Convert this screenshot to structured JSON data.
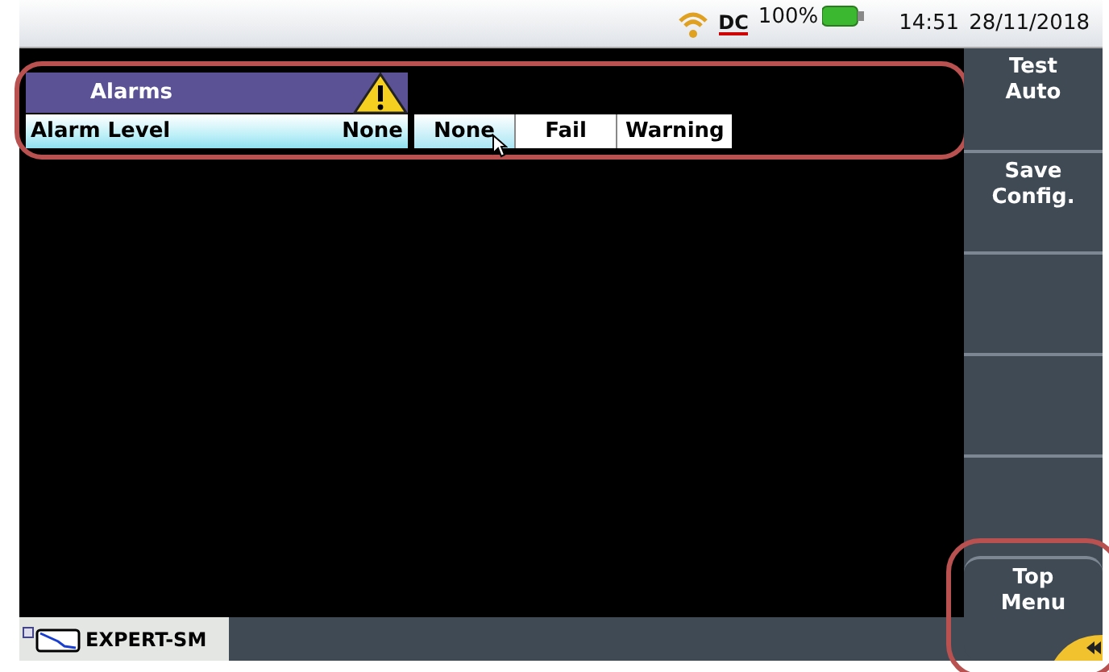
{
  "status_bar": {
    "power_source": "DC",
    "battery": "100%",
    "time": "14:51",
    "date": "28/11/2018"
  },
  "alarms": {
    "title": "Alarms",
    "warning": true,
    "highlighted": true,
    "rows": [
      {
        "label": "Alarm Level",
        "value": "None",
        "options": [
          {
            "label": "None",
            "selected": true
          },
          {
            "label": "Fail",
            "selected": false
          },
          {
            "label": "Warning",
            "selected": false
          }
        ]
      }
    ]
  },
  "softkeys": [
    {
      "kind": "label",
      "lines": [
        "Test",
        "Auto"
      ]
    },
    {
      "kind": "label",
      "lines": [
        "Save",
        "Config."
      ]
    },
    {
      "kind": "blank"
    },
    {
      "kind": "blank"
    },
    {
      "kind": "blank"
    },
    {
      "kind": "label",
      "lines": [
        "Top",
        "Menu"
      ],
      "highlighted": true
    }
  ],
  "bottom_tab": {
    "label": "EXPERT-SM"
  }
}
